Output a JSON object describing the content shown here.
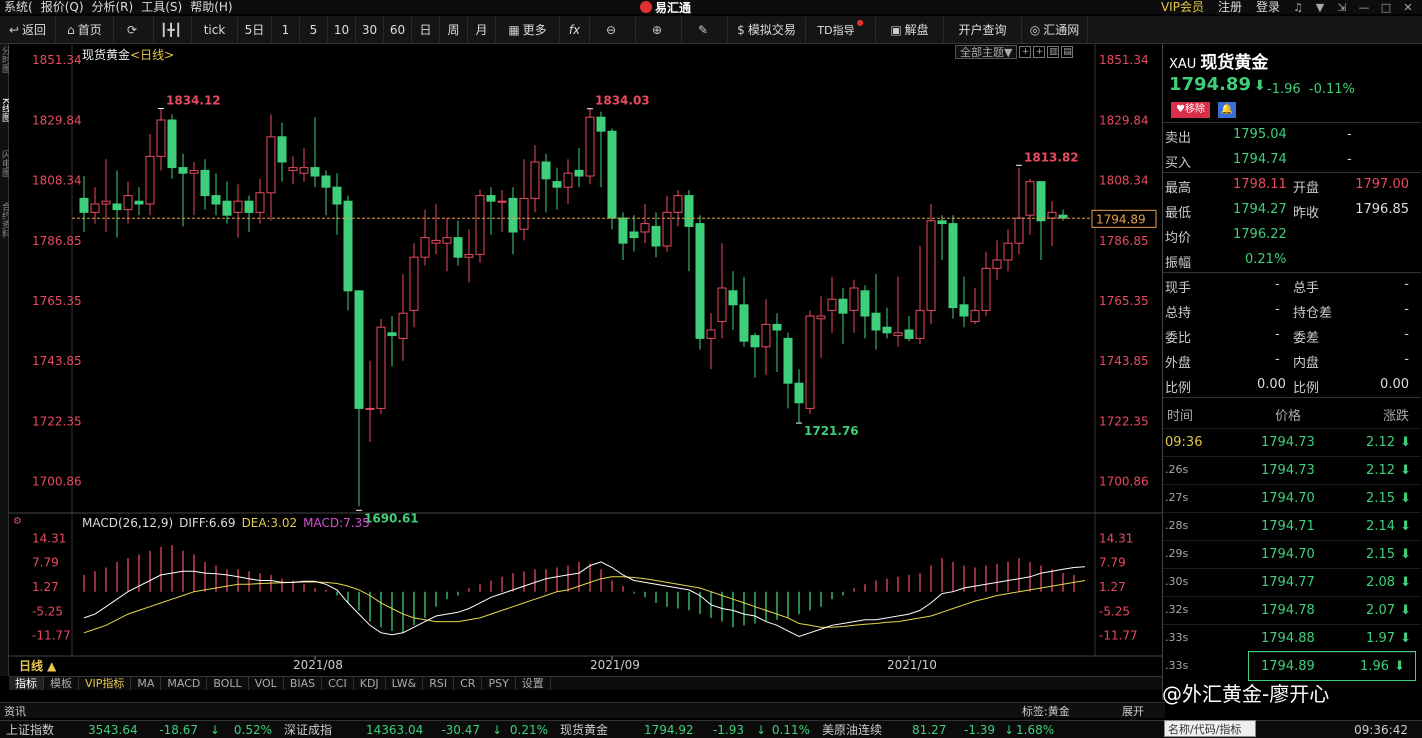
{
  "menu": {
    "items": [
      "系统(",
      "报价(Q)",
      "分析(R)",
      "工具(S)",
      "帮助(H)"
    ],
    "app_title": "易汇通",
    "right": [
      "VIP会员",
      "注册",
      "登录"
    ]
  },
  "toolbar": {
    "back": "返回",
    "home": "首页",
    "tick": "tick",
    "d5": "5日",
    "p1": "1",
    "p5": "5",
    "p10": "10",
    "p30": "30",
    "p60": "60",
    "day": "日",
    "week": "周",
    "month": "月",
    "more": "更多",
    "fx": "fx",
    "draw": "",
    "sim": "模拟交易",
    "td": "TD指导",
    "jiepan": "解盘",
    "account": "开户查询",
    "huitong": "汇通网"
  },
  "left_tabs": [
    "分时图",
    "K线图",
    "闪电图",
    "合约资料"
  ],
  "chart": {
    "title": "现货黄金",
    "period": "<日线>",
    "theme_select": "全部主题▼",
    "price_axis": [
      "1851.34",
      "1829.84",
      "1808.34",
      "1786.85",
      "1765.35",
      "1743.85",
      "1722.35",
      "1700.86"
    ],
    "current_price_tag": "1794.89",
    "annotations": [
      "1834.12",
      "1834.03",
      "1813.82",
      "1690.61",
      "1721.76"
    ],
    "dates": [
      "2021/08",
      "2021/09",
      "2021/10"
    ],
    "period_label": "日线 ▲"
  },
  "macd": {
    "label": "MACD(26,12,9)",
    "diff": "DIFF:6.69",
    "dea": "DEA:3.02",
    "macd": "MACD:7.35",
    "axis": [
      "14.31",
      "7.79",
      "1.27",
      "-5.25",
      "-11.77"
    ]
  },
  "indicator_tabs": [
    "指标",
    "模板",
    "VIP指标",
    "MA",
    "MACD",
    "BOLL",
    "VOL",
    "BIAS",
    "CCI",
    "KDJ",
    "LW&",
    "RSI",
    "CR",
    "PSY",
    "设置"
  ],
  "info_bar": {
    "left": "资讯",
    "tag": "标签:黄金",
    "expand": "展开"
  },
  "ticker": [
    {
      "name": "上证指数",
      "price": "3543.64",
      "chg": "-18.67",
      "pct": "0.52%"
    },
    {
      "name": "深证成指",
      "price": "14363.04",
      "chg": "-30.47",
      "pct": "0.21%"
    },
    {
      "name": "现货黄金",
      "price": "1794.92",
      "chg": "-1.93",
      "pct": "0.11%"
    },
    {
      "name": "美原油连续",
      "price": "81.27",
      "chg": "-1.39",
      "pct": "1.68%"
    }
  ],
  "clock": "09:36:42",
  "search_placeholder": "名称/代码/指标",
  "watermark": "@外汇黄金-廖开心",
  "quote": {
    "code": "XAU",
    "name": "现货黄金",
    "price": "1794.89",
    "arrow": "⬇",
    "change": "-1.96",
    "pct": "-0.11%",
    "remove_btn": "♥移除",
    "sell_label": "卖出",
    "sell": "1795.04",
    "sell_dash": "-",
    "buy_label": "买入",
    "buy": "1794.74",
    "buy_dash": "-",
    "high_label": "最高",
    "high": "1798.11",
    "open_label": "开盘",
    "open": "1797.00",
    "low_label": "最低",
    "low": "1794.27",
    "prev_label": "昨收",
    "prev": "1796.85",
    "avg_label": "均价",
    "avg": "1796.22",
    "amp_label": "振幅",
    "amp": "0.21%",
    "stats": [
      {
        "l1": "现手",
        "v1": "-",
        "l2": "总手",
        "v2": "-"
      },
      {
        "l1": "总持",
        "v1": "-",
        "l2": "持仓差",
        "v2": "-"
      },
      {
        "l1": "委比",
        "v1": "-",
        "l2": "委差",
        "v2": "-"
      },
      {
        "l1": "外盘",
        "v1": "-",
        "l2": "内盘",
        "v2": "-"
      },
      {
        "l1": "比例",
        "v1": "0.00",
        "l2": "比例",
        "v2": "0.00"
      }
    ],
    "ticks_header": {
      "time": "时间",
      "price": "价格",
      "chg": "涨跌"
    },
    "ticks": [
      {
        "t": "09:36",
        "p": "1794.73",
        "c": "2.12"
      },
      {
        "t": ".26s",
        "p": "1794.73",
        "c": "2.12"
      },
      {
        "t": ".27s",
        "p": "1794.70",
        "c": "2.15"
      },
      {
        "t": ".28s",
        "p": "1794.71",
        "c": "2.14"
      },
      {
        "t": ".29s",
        "p": "1794.70",
        "c": "2.15"
      },
      {
        "t": ".30s",
        "p": "1794.77",
        "c": "2.08"
      },
      {
        "t": ".32s",
        "p": "1794.78",
        "c": "2.07"
      },
      {
        "t": ".33s",
        "p": "1794.88",
        "c": "1.97"
      },
      {
        "t": ".33s",
        "p": "1794.89",
        "c": "1.96"
      }
    ]
  },
  "chart_data": {
    "type": "candlestick",
    "title": "现货黄金",
    "ylim": [
      1690,
      1855
    ],
    "candles": [
      [
        1802,
        1797,
        1810,
        1790
      ],
      [
        1797,
        1800,
        1806,
        1793
      ],
      [
        1800,
        1801,
        1816,
        1790
      ],
      [
        1800,
        1798,
        1812,
        1788
      ],
      [
        1798,
        1803,
        1808,
        1793
      ],
      [
        1801,
        1800,
        1806,
        1796
      ],
      [
        1800,
        1817,
        1825,
        1796
      ],
      [
        1817,
        1830,
        1834,
        1812
      ],
      [
        1830,
        1813,
        1832,
        1809
      ],
      [
        1813,
        1811,
        1818,
        1792
      ],
      [
        1811,
        1812,
        1815,
        1796
      ],
      [
        1812,
        1803,
        1816,
        1798
      ],
      [
        1803,
        1800,
        1811,
        1796
      ],
      [
        1801,
        1796,
        1808,
        1793
      ],
      [
        1797,
        1801,
        1807,
        1788
      ],
      [
        1801,
        1797,
        1803,
        1790
      ],
      [
        1797,
        1804,
        1809,
        1793
      ],
      [
        1804,
        1824,
        1832,
        1794
      ],
      [
        1824,
        1815,
        1829,
        1808
      ],
      [
        1812,
        1813,
        1817,
        1807
      ],
      [
        1811,
        1813,
        1820,
        1808
      ],
      [
        1813,
        1810,
        1831,
        1806
      ],
      [
        1810,
        1806,
        1812,
        1796
      ],
      [
        1806,
        1800,
        1811,
        1789
      ],
      [
        1801,
        1769,
        1803,
        1762
      ],
      [
        1769,
        1727,
        1768,
        1692
      ],
      [
        1727,
        1727,
        1744,
        1715
      ],
      [
        1727,
        1756,
        1759,
        1725
      ],
      [
        1754,
        1753,
        1760,
        1742
      ],
      [
        1752,
        1761,
        1775,
        1744
      ],
      [
        1762,
        1781,
        1786,
        1756
      ],
      [
        1781,
        1788,
        1798,
        1778
      ],
      [
        1786,
        1787,
        1800,
        1782
      ],
      [
        1786,
        1788,
        1795,
        1776
      ],
      [
        1788,
        1781,
        1794,
        1778
      ],
      [
        1781,
        1782,
        1791,
        1772
      ],
      [
        1782,
        1803,
        1805,
        1779
      ],
      [
        1803,
        1801,
        1806,
        1789
      ],
      [
        1801,
        1801,
        1805,
        1790
      ],
      [
        1802,
        1790,
        1806,
        1782
      ],
      [
        1791,
        1802,
        1816,
        1787
      ],
      [
        1802,
        1815,
        1821,
        1797
      ],
      [
        1815,
        1809,
        1818,
        1797
      ],
      [
        1808,
        1806,
        1813,
        1798
      ],
      [
        1806,
        1811,
        1816,
        1800
      ],
      [
        1812,
        1810,
        1820,
        1806
      ],
      [
        1810,
        1831,
        1834,
        1807
      ],
      [
        1831,
        1826,
        1833,
        1806
      ],
      [
        1826,
        1795,
        1827,
        1791
      ],
      [
        1795,
        1786,
        1797,
        1780
      ],
      [
        1790,
        1788,
        1796,
        1783
      ],
      [
        1790,
        1793,
        1800,
        1786
      ],
      [
        1792,
        1785,
        1797,
        1781
      ],
      [
        1785,
        1797,
        1803,
        1783
      ],
      [
        1797,
        1803,
        1805,
        1792
      ],
      [
        1803,
        1792,
        1805,
        1776
      ],
      [
        1793,
        1752,
        1796,
        1748
      ],
      [
        1752,
        1755,
        1761,
        1741
      ],
      [
        1758,
        1770,
        1786,
        1752
      ],
      [
        1769,
        1764,
        1776,
        1755
      ],
      [
        1764,
        1751,
        1774,
        1749
      ],
      [
        1753,
        1749,
        1754,
        1738
      ],
      [
        1749,
        1757,
        1766,
        1739
      ],
      [
        1757,
        1755,
        1761,
        1740
      ],
      [
        1752,
        1736,
        1754,
        1727
      ],
      [
        1736,
        1729,
        1741,
        1722
      ],
      [
        1727,
        1760,
        1762,
        1725
      ],
      [
        1759,
        1760,
        1767,
        1745
      ],
      [
        1762,
        1766,
        1774,
        1754
      ],
      [
        1766,
        1761,
        1770,
        1750
      ],
      [
        1762,
        1770,
        1773,
        1754
      ],
      [
        1769,
        1760,
        1771,
        1752
      ],
      [
        1761,
        1755,
        1775,
        1748
      ],
      [
        1756,
        1754,
        1763,
        1752
      ],
      [
        1753,
        1754,
        1774,
        1749
      ],
      [
        1755,
        1752,
        1760,
        1751
      ],
      [
        1752,
        1762,
        1785,
        1750
      ],
      [
        1762,
        1794,
        1800,
        1757
      ],
      [
        1794,
        1793,
        1796,
        1780
      ],
      [
        1793,
        1763,
        1796,
        1759
      ],
      [
        1764,
        1760,
        1774,
        1756
      ],
      [
        1758,
        1762,
        1770,
        1757
      ],
      [
        1762,
        1777,
        1783,
        1760
      ],
      [
        1777,
        1780,
        1787,
        1773
      ],
      [
        1780,
        1786,
        1791,
        1776
      ],
      [
        1786,
        1795,
        1813,
        1782
      ],
      [
        1796,
        1808,
        1809,
        1789
      ],
      [
        1808,
        1794,
        1806,
        1780
      ],
      [
        1795,
        1797,
        1801,
        1785
      ],
      [
        1796,
        1795,
        1798,
        1794
      ]
    ],
    "macd": {
      "axis_range": [
        -14,
        16
      ],
      "hist": [
        4.5,
        5.5,
        6.5,
        8,
        9,
        10,
        11,
        12,
        12.5,
        11,
        10,
        8,
        7,
        6,
        6,
        5.5,
        5,
        4.5,
        3.5,
        3,
        2,
        1,
        0.5,
        -1,
        -3,
        -5,
        -8,
        -9.5,
        -10.5,
        -11,
        -9,
        -7,
        -4,
        -2,
        -1,
        1,
        2,
        3,
        4,
        5,
        5.5,
        6,
        6,
        6.5,
        7,
        8,
        7.5,
        6,
        3,
        1.5,
        -0.5,
        -1.5,
        -3,
        -4,
        -4.5,
        -5,
        -6,
        -7,
        -8,
        -9.5,
        -9,
        -8.5,
        -8,
        -7.5,
        -7,
        -6,
        -5,
        -4,
        -2,
        -1,
        1,
        2,
        3,
        3.5,
        4,
        4.5,
        5,
        7,
        9,
        8,
        7,
        6.5,
        7,
        7.5,
        8,
        9,
        8,
        7,
        6,
        5,
        4.5
      ],
      "diff": [
        -7,
        -6,
        -4,
        -2,
        0,
        1.5,
        3,
        4.5,
        5,
        5.5,
        5.5,
        5,
        4.8,
        4.5,
        4,
        3.5,
        3,
        3,
        2.5,
        2.5,
        2.8,
        2.8,
        2,
        0.5,
        -3,
        -6,
        -9,
        -11,
        -11.5,
        -11,
        -9.5,
        -8,
        -6.5,
        -6,
        -5.5,
        -4.5,
        -3,
        -1.5,
        -0.5,
        0.5,
        1.5,
        2.5,
        3.5,
        4,
        4.5,
        5,
        7,
        8,
        6.5,
        4.5,
        3,
        2.5,
        2,
        1.5,
        1,
        0.5,
        -1,
        -3.5,
        -4.5,
        -5,
        -6,
        -6.5,
        -8,
        -9,
        -10.5,
        -12,
        -11,
        -10,
        -9,
        -8.5,
        -8,
        -7.5,
        -7.5,
        -7,
        -6.5,
        -6,
        -5,
        -3,
        -0.5,
        0,
        1,
        1.5,
        2,
        2.5,
        3,
        3.5,
        4,
        5,
        5.5,
        6,
        6.5,
        6.69
      ],
      "dea": [
        -11,
        -10,
        -9,
        -7.5,
        -6,
        -5,
        -4,
        -3,
        -2,
        -1,
        0,
        0.5,
        1,
        1.5,
        2,
        2,
        2.2,
        2.3,
        2.4,
        2.5,
        2.6,
        2.6,
        2.5,
        2.2,
        1.5,
        0.5,
        -1,
        -3,
        -4.5,
        -6,
        -7,
        -7.5,
        -8,
        -8,
        -8,
        -7.5,
        -7,
        -6,
        -5,
        -4,
        -3,
        -2,
        -1,
        0,
        0.5,
        1.5,
        2.5,
        3.5,
        4,
        4,
        3.8,
        3.5,
        3,
        2.5,
        2,
        1.5,
        1,
        0,
        -1,
        -2,
        -3,
        -4,
        -5,
        -6,
        -7,
        -8.5,
        -9,
        -9.5,
        -9.5,
        -9.3,
        -9,
        -8.7,
        -8.5,
        -8.2,
        -8,
        -7.5,
        -7,
        -6.5,
        -5.5,
        -4.5,
        -3.5,
        -2.5,
        -1.8,
        -1,
        -0.5,
        0,
        0.5,
        1,
        1.5,
        2,
        2.5,
        3.02
      ]
    }
  }
}
